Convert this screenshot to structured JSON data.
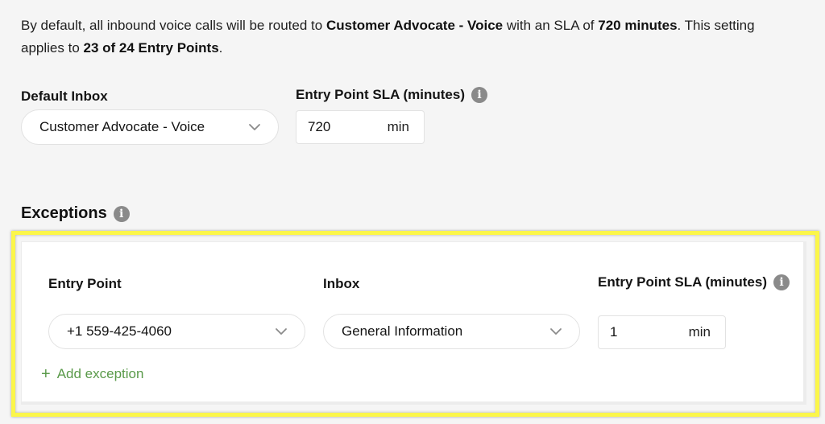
{
  "description": {
    "part1": "By default, all inbound voice calls will be routed to ",
    "inbox_bold": "Customer Advocate - Voice",
    "part2": " with an SLA of ",
    "sla_bold": "720 minutes",
    "part3": ". This setting applies to ",
    "applies_bold": "23 of 24 Entry Points",
    "part4": "."
  },
  "default_settings": {
    "inbox_label": "Default Inbox",
    "inbox_value": "Customer Advocate - Voice",
    "sla_label": "Entry Point SLA (minutes)",
    "sla_value": "720",
    "sla_unit": "min"
  },
  "exceptions": {
    "heading": "Exceptions",
    "columns": {
      "entry_point": "Entry Point",
      "inbox": "Inbox",
      "sla": "Entry Point SLA (minutes)"
    },
    "rows": [
      {
        "entry_point": "+1 559-425-4060",
        "inbox": "General Information",
        "sla_value": "1",
        "sla_unit": "min"
      }
    ],
    "add_label": "Add exception",
    "add_icon": "+"
  },
  "icons": {
    "info": "i",
    "chevron": "chevron-down-icon"
  },
  "colors": {
    "accent_green": "#5a9a4a",
    "highlight_yellow": "#fbf64a",
    "info_gray": "#8a8a8a"
  }
}
